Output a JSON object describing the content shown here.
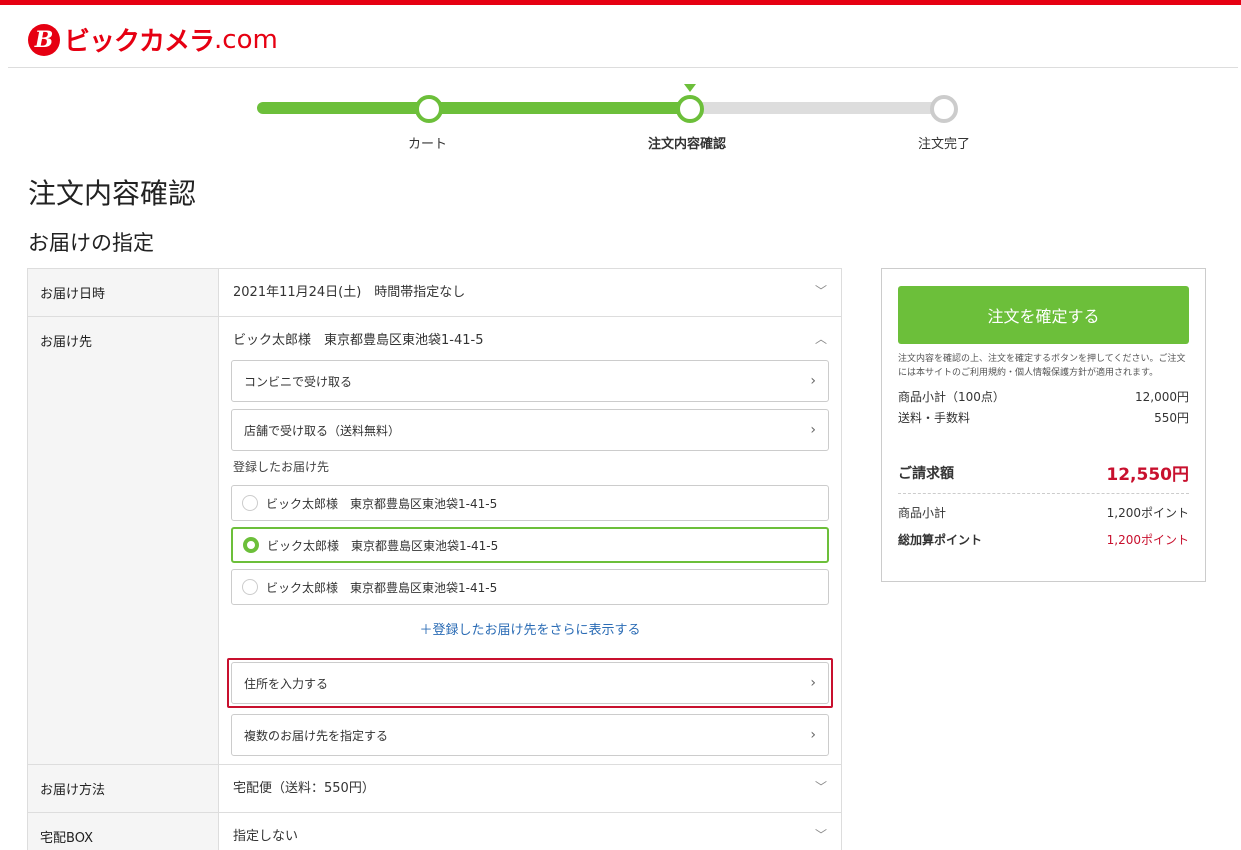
{
  "brand": {
    "mark": "B",
    "name": "ビックカメラ",
    "domain": ".com"
  },
  "stepper": {
    "steps": [
      {
        "label": "カート",
        "state": "done"
      },
      {
        "label": "注文内容確認",
        "state": "current"
      },
      {
        "label": "注文完了",
        "state": "todo"
      }
    ]
  },
  "page": {
    "title": "注文内容確認",
    "section_title": "お届けの指定"
  },
  "delivery": {
    "date_label": "お届け日時",
    "date_value": "2021年11月24日(土)　時間帯指定なし",
    "dest_label": "お届け先",
    "dest_value": "ビック太郎様　東京都豊島区東池袋1-41-5",
    "convenience": "コンビニで受け取る",
    "store": "店舗で受け取る（送料無料）",
    "registered_label": "登録したお届け先",
    "registered": [
      {
        "text": "ビック太郎様　東京都豊島区東池袋1-41-5",
        "selected": false
      },
      {
        "text": "ビック太郎様　東京都豊島区東池袋1-41-5",
        "selected": true
      },
      {
        "text": "ビック太郎様　東京都豊島区東池袋1-41-5",
        "selected": false
      }
    ],
    "more_link": "＋登録したお届け先をさらに表示する",
    "enter_address": "住所を入力する",
    "multiple": "複数のお届け先を指定する",
    "method_label": "お届け方法",
    "method_value": "宅配便（送料：550円）",
    "box_label": "宅配BOX",
    "box_value": "指定しない"
  },
  "summary": {
    "confirm_button": "注文を確定する",
    "note": "注文内容を確認の上、注文を確定するボタンを押してください。ご注文には本サイトのご利用規約・個人情報保護方針が適用されます。",
    "subtotal_label": "商品小計（100点）",
    "subtotal_value": "12,000円",
    "shipping_label": "送料・手数料",
    "shipping_value": "550円",
    "total_label": "ご請求額",
    "total_value": "12,550円",
    "points_label": "商品小計",
    "points_value": "1,200ポイント",
    "total_points_label": "総加算ポイント",
    "total_points_value": "1,200ポイント"
  },
  "colors": {
    "brand_red": "#e60012",
    "accent_green": "#6cbf3a",
    "highlight_red": "#c8102e",
    "link_blue": "#2b6cb5"
  }
}
